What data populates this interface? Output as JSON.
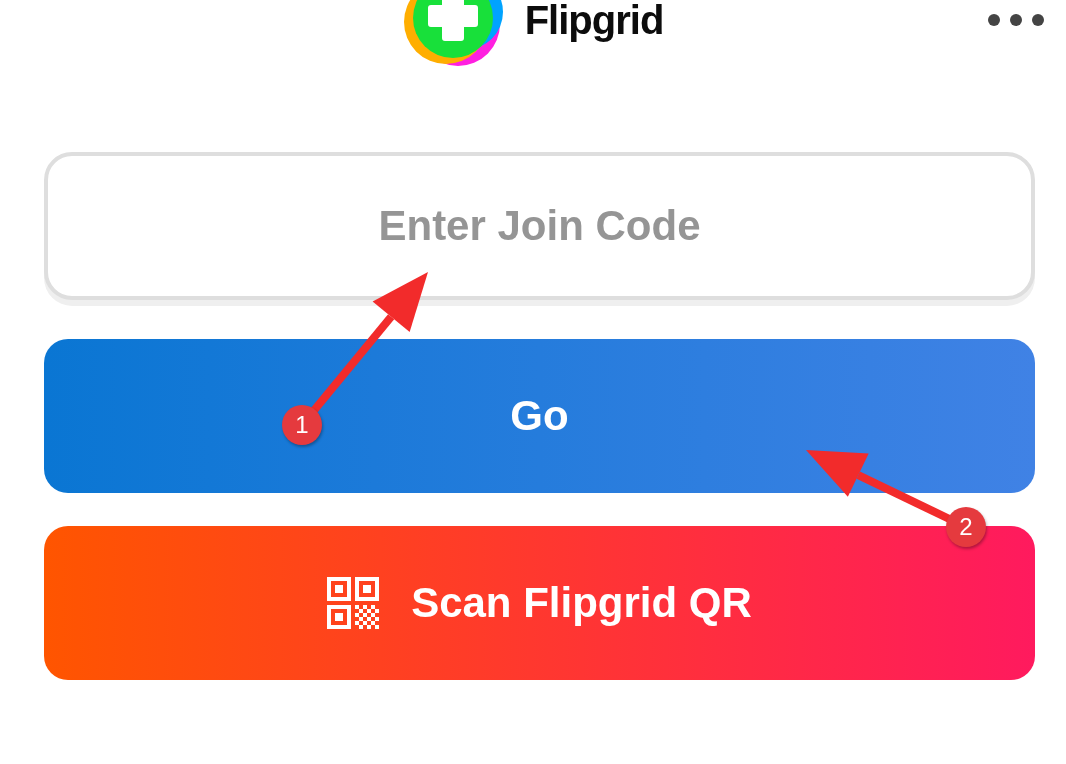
{
  "header": {
    "app_name": "Flipgrid"
  },
  "join_code": {
    "placeholder": "Enter Join Code"
  },
  "go_button": {
    "label": "Go"
  },
  "scan_button": {
    "label": "Scan Flipgrid QR"
  },
  "annotations": [
    {
      "label": "1"
    },
    {
      "label": "2"
    }
  ]
}
